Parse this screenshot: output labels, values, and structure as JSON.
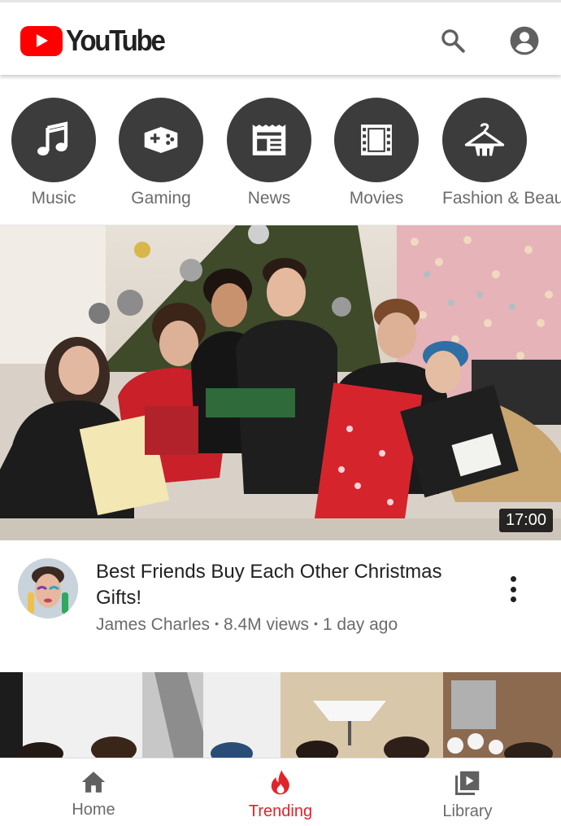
{
  "app": {
    "name": "YouTube",
    "brand_red": "#ff0000",
    "accent_active": "#e1232a"
  },
  "header": {
    "search_icon": "search-icon",
    "account_icon": "account-circle-icon"
  },
  "categories": [
    {
      "label": "Music",
      "icon": "music-note-icon"
    },
    {
      "label": "Gaming",
      "icon": "gamepad-icon"
    },
    {
      "label": "News",
      "icon": "newspaper-icon"
    },
    {
      "label": "Movies",
      "icon": "film-strip-icon"
    },
    {
      "label": "Fashion & Beau",
      "icon": "clothes-hanger-icon"
    }
  ],
  "videos": [
    {
      "duration": "17:00",
      "title": "Best Friends Buy Each Other Christmas Gifts!",
      "channel": "James Charles",
      "views": "8.4M views",
      "age": "1 day ago"
    }
  ],
  "bottom_nav": [
    {
      "label": "Home",
      "icon": "home-icon",
      "active": false
    },
    {
      "label": "Trending",
      "icon": "flame-icon",
      "active": true
    },
    {
      "label": "Library",
      "icon": "library-icon",
      "active": false
    }
  ]
}
